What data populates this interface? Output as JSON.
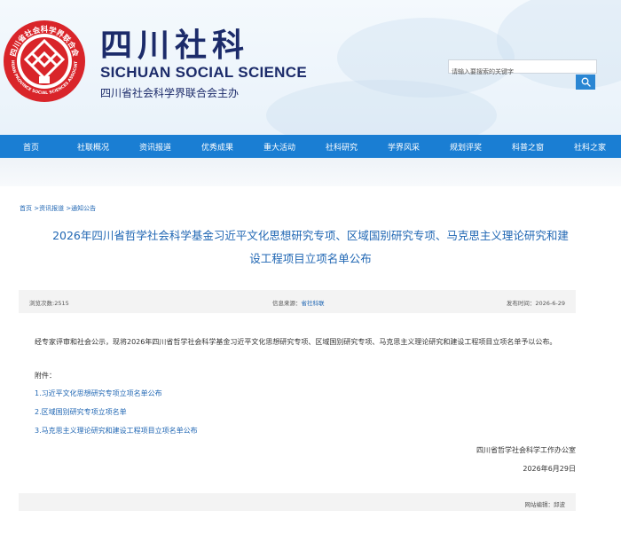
{
  "header": {
    "seal_text": "四川省社会科学界联合会",
    "seal_text_en": "SICHUAN PROVINCE SOCIAL SCIENCES ASSOCIATION",
    "brand_cn": "四川社科",
    "brand_en": "SICHUAN SOCIAL SCIENCE",
    "brand_org": "四川省社会科学界联合会主办",
    "search": {
      "placeholder": "请输入要搜索的关键字"
    }
  },
  "nav": {
    "items": [
      {
        "label": "首页"
      },
      {
        "label": "社联概况"
      },
      {
        "label": "资讯报道"
      },
      {
        "label": "优秀成果"
      },
      {
        "label": "重大活动"
      },
      {
        "label": "社科研究"
      },
      {
        "label": "学界风采"
      },
      {
        "label": "规划评奖"
      },
      {
        "label": "科普之窗"
      },
      {
        "label": "社科之家"
      }
    ]
  },
  "breadcrumb": "首页 >资讯报道 >通知公告",
  "article": {
    "title_line1": "2026年四川省哲学社会科学基金习近平文化思想研究专项、区域国别研究专项、马克思主义理论研究和建",
    "title_line2": "设工程项目立项名单公布",
    "views": "浏览次数:2515",
    "source_label": "信息来源：",
    "source_value": "省社科联",
    "publish_date": "发布时间：2026-6-29",
    "body": "经专家评审和社会公示，现将2026年四川省哲学社会科学基金习近平文化思想研究专项、区域国别研究专项、马克思主义理论研究和建设工程项目立项名单予以公布。",
    "attachments_label": "附件：",
    "attachments": [
      "1.习近平文化思想研究专项立项名单公布",
      "2.区域国别研究专项立项名单",
      "3.马克思主义理论研究和建设工程项目立项名单公布"
    ],
    "signature": "四川省哲学社会科学工作办公室",
    "sign_date": "2026年6月29日",
    "editor": "网站编辑：邱波"
  },
  "colors": {
    "nav_blue": "#1a7ed3",
    "link_blue": "#1f66b3",
    "brand_navy": "#1c2b6a",
    "seal_red": "#d9252a"
  }
}
